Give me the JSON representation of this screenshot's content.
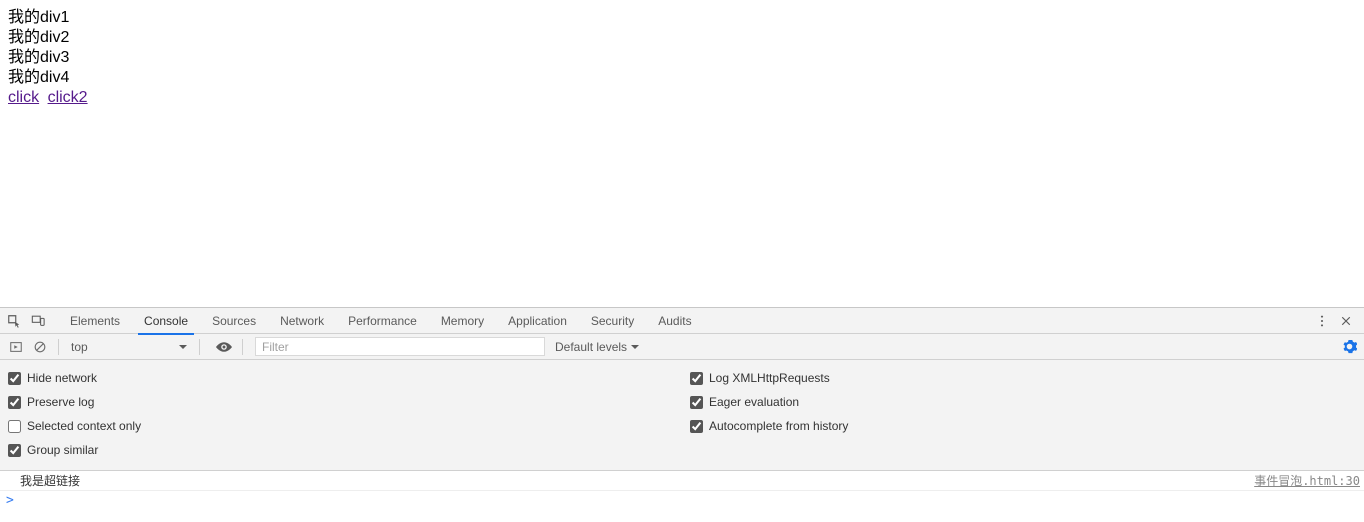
{
  "page": {
    "divs": [
      "我的div1",
      "我的div2",
      "我的div3",
      "我的div4"
    ],
    "links": [
      "click",
      "click2"
    ]
  },
  "devtools": {
    "tabs": [
      "Elements",
      "Console",
      "Sources",
      "Network",
      "Performance",
      "Memory",
      "Application",
      "Security",
      "Audits"
    ],
    "active_tab_index": 1,
    "toolbar": {
      "context_label": "top",
      "filter_placeholder": "Filter",
      "levels_label": "Default levels"
    },
    "settings": {
      "left": [
        {
          "label": "Hide network",
          "checked": true
        },
        {
          "label": "Preserve log",
          "checked": true
        },
        {
          "label": "Selected context only",
          "checked": false
        },
        {
          "label": "Group similar",
          "checked": true
        }
      ],
      "right": [
        {
          "label": "Log XMLHttpRequests",
          "checked": true
        },
        {
          "label": "Eager evaluation",
          "checked": true
        },
        {
          "label": "Autocomplete from history",
          "checked": true
        }
      ]
    },
    "console": {
      "messages": [
        {
          "text": "我是超链接",
          "source": "事件冒泡.html:30"
        }
      ],
      "prompt": ">"
    }
  }
}
